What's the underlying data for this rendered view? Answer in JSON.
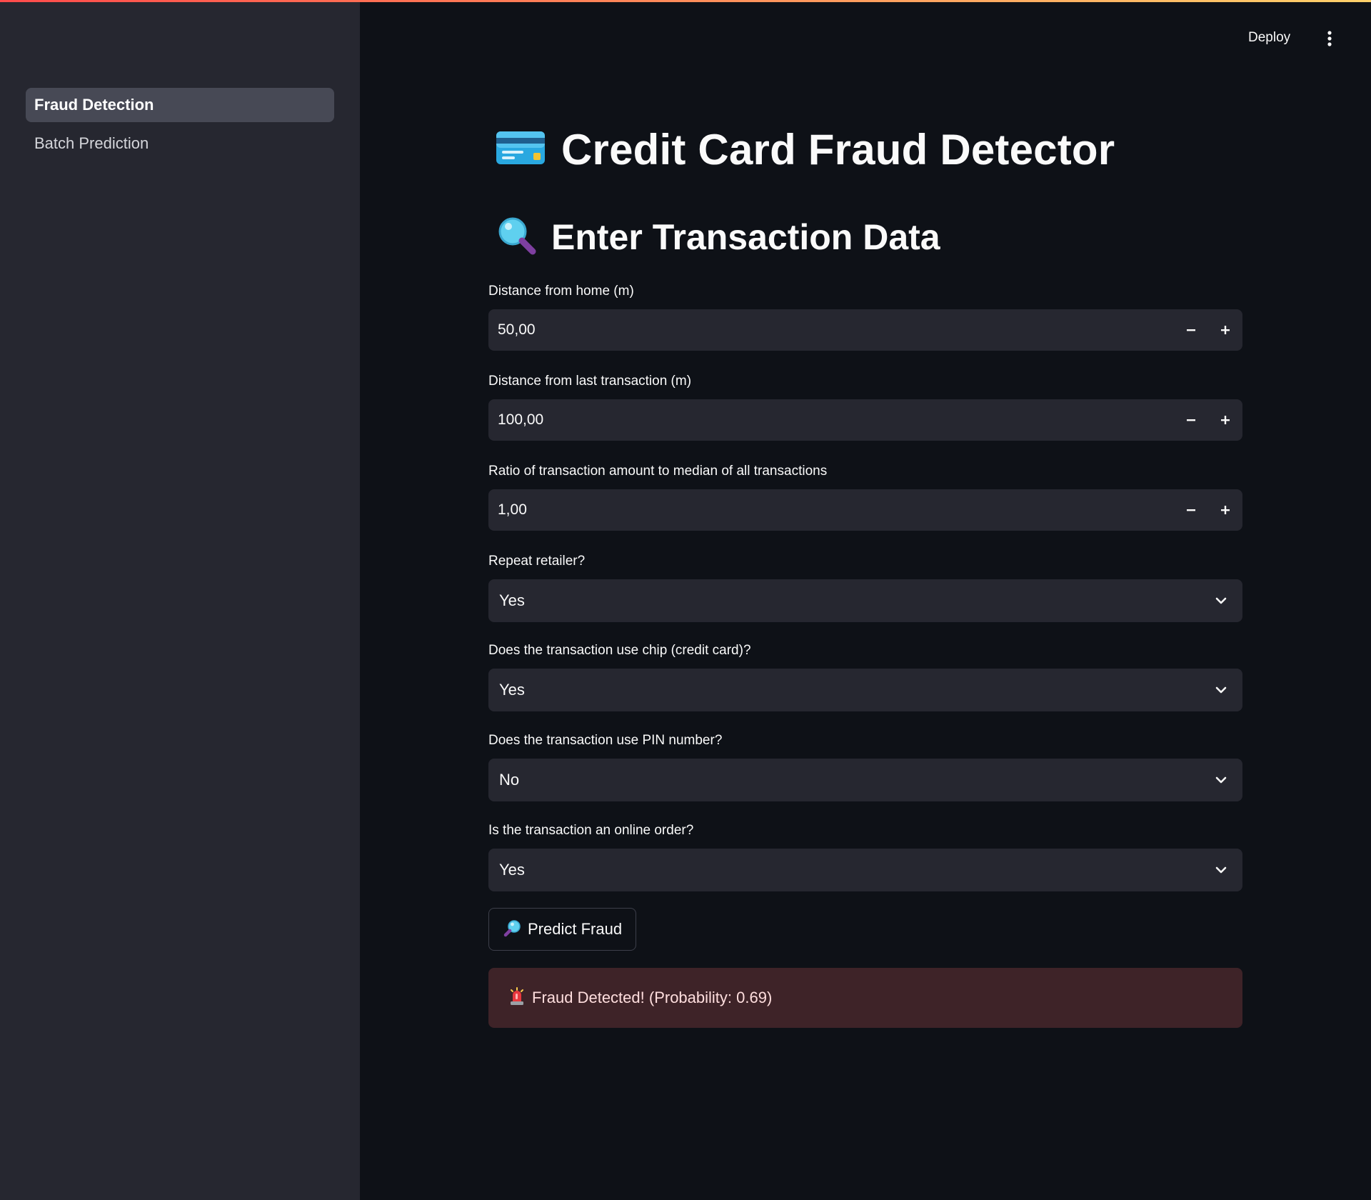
{
  "sidebar": {
    "items": [
      {
        "label": "Fraud Detection",
        "active": true
      },
      {
        "label": "Batch Prediction",
        "active": false
      }
    ]
  },
  "header": {
    "deploy_label": "Deploy",
    "menu_icon": "vertical-dots-icon"
  },
  "main": {
    "title": "Credit Card Fraud Detector",
    "title_icon": "credit-card-icon",
    "subtitle": "Enter Transaction Data",
    "subtitle_icon": "magnifying-glass-icon",
    "fields": [
      {
        "label": "Distance from home (m)",
        "type": "number",
        "value": "50,00"
      },
      {
        "label": "Distance from last transaction (m)",
        "type": "number",
        "value": "100,00"
      },
      {
        "label": "Ratio of transaction amount to median of all transactions",
        "type": "number",
        "value": "1,00"
      },
      {
        "label": "Repeat retailer?",
        "type": "select",
        "value": "Yes"
      },
      {
        "label": "Does the transaction use chip (credit card)?",
        "type": "select",
        "value": "Yes"
      },
      {
        "label": "Does the transaction use PIN number?",
        "type": "select",
        "value": "No"
      },
      {
        "label": "Is the transaction an online order?",
        "type": "select",
        "value": "Yes"
      }
    ],
    "predict_button": {
      "label": "Predict Fraud",
      "icon": "magnifying-glass-icon"
    },
    "result": {
      "text": "Fraud Detected! (Probability: 0.69)",
      "icon": "siren-icon"
    }
  },
  "colors": {
    "background": "#0e1117",
    "sidebar": "#262730",
    "input": "#262730",
    "alert_bg": "#3e2328",
    "accent": "#ff4b4b"
  }
}
